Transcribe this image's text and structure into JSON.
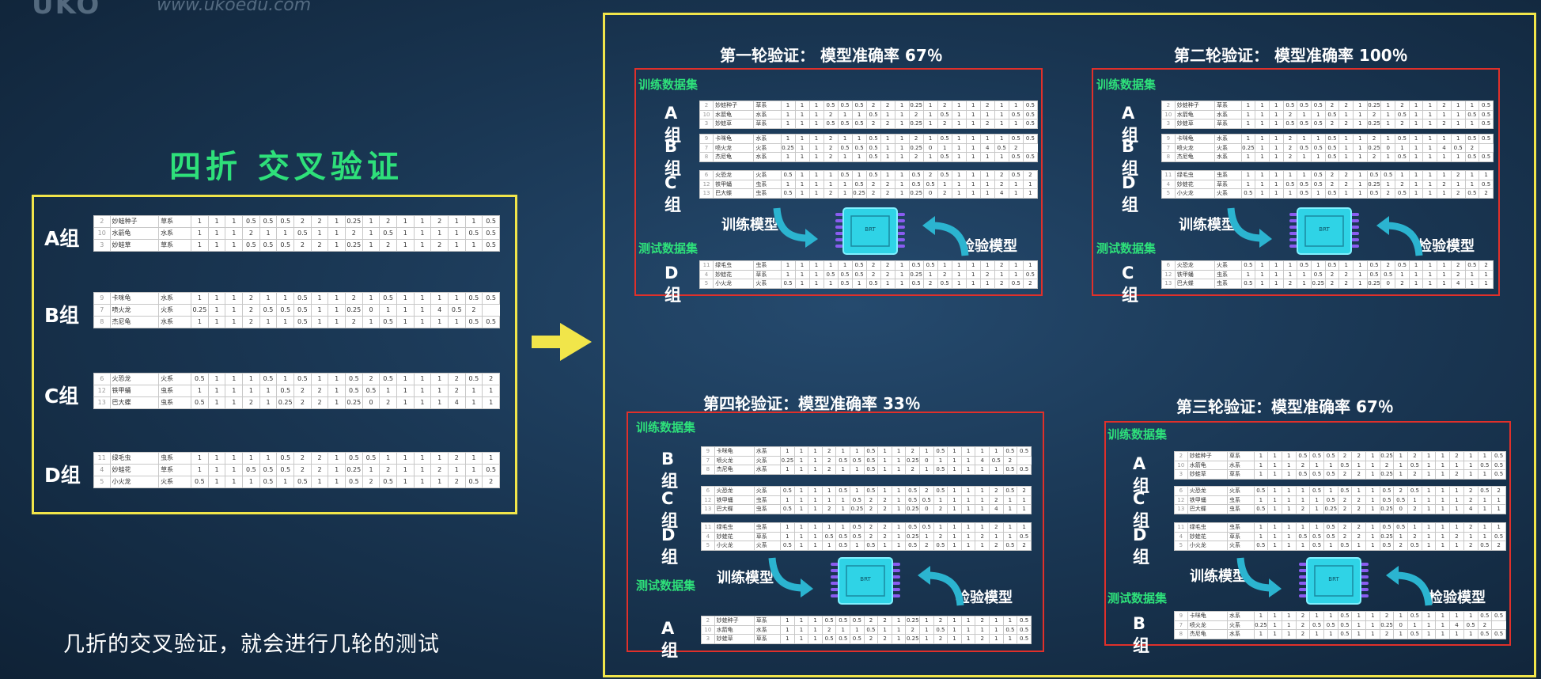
{
  "watermark": {
    "logo": "UKO",
    "url": "www.ukoedu.com"
  },
  "title": "四折 交叉验证",
  "caption": "几折的交叉验证，就会进行几轮的测试",
  "labels": {
    "train_set": "训练数据集",
    "test_set": "测试数据集",
    "train_model": "训练模型",
    "test_model": "检验模型",
    "chip": "BRT"
  },
  "groups": {
    "A": {
      "label": "A组",
      "rows": [
        [
          "2",
          "妙蛙种子",
          "草系",
          "1",
          "1",
          "1",
          "0.5",
          "0.5",
          "0.5",
          "2",
          "2",
          "1",
          "0.25",
          "1",
          "2",
          "1",
          "1",
          "2",
          "1",
          "1",
          "0.5"
        ],
        [
          "10",
          "水箭龟",
          "水系",
          "1",
          "1",
          "1",
          "2",
          "1",
          "1",
          "0.5",
          "1",
          "1",
          "2",
          "1",
          "0.5",
          "1",
          "1",
          "1",
          "1",
          "0.5",
          "0.5"
        ],
        [
          "3",
          "妙蛙草",
          "草系",
          "1",
          "1",
          "1",
          "0.5",
          "0.5",
          "0.5",
          "2",
          "2",
          "1",
          "0.25",
          "1",
          "2",
          "1",
          "1",
          "2",
          "1",
          "1",
          "0.5"
        ]
      ]
    },
    "B": {
      "label": "B组",
      "rows": [
        [
          "9",
          "卡咪龟",
          "水系",
          "1",
          "1",
          "1",
          "2",
          "1",
          "1",
          "0.5",
          "1",
          "1",
          "2",
          "1",
          "0.5",
          "1",
          "1",
          "1",
          "1",
          "0.5",
          "0.5"
        ],
        [
          "7",
          "喷火龙",
          "火系",
          "0.25",
          "1",
          "1",
          "2",
          "0.5",
          "0.5",
          "0.5",
          "1",
          "1",
          "0.25",
          "0",
          "1",
          "1",
          "1",
          "4",
          "0.5",
          "2"
        ],
        [
          "8",
          "杰尼龟",
          "水系",
          "1",
          "1",
          "1",
          "2",
          "1",
          "1",
          "0.5",
          "1",
          "1",
          "2",
          "1",
          "0.5",
          "1",
          "1",
          "1",
          "1",
          "0.5",
          "0.5"
        ]
      ]
    },
    "C": {
      "label": "C组",
      "rows": [
        [
          "6",
          "火恐龙",
          "火系",
          "0.5",
          "1",
          "1",
          "1",
          "0.5",
          "1",
          "0.5",
          "1",
          "1",
          "0.5",
          "2",
          "0.5",
          "1",
          "1",
          "1",
          "2",
          "0.5",
          "2"
        ],
        [
          "12",
          "铁甲蛹",
          "虫系",
          "1",
          "1",
          "1",
          "1",
          "1",
          "0.5",
          "2",
          "2",
          "1",
          "0.5",
          "0.5",
          "1",
          "1",
          "1",
          "1",
          "2",
          "1",
          "1"
        ],
        [
          "13",
          "巴大蝶",
          "虫系",
          "0.5",
          "1",
          "1",
          "2",
          "1",
          "0.25",
          "2",
          "2",
          "1",
          "0.25",
          "0",
          "2",
          "1",
          "1",
          "1",
          "4",
          "1",
          "1"
        ]
      ]
    },
    "D": {
      "label": "D组",
      "rows": [
        [
          "11",
          "绿毛虫",
          "虫系",
          "1",
          "1",
          "1",
          "1",
          "1",
          "0.5",
          "2",
          "2",
          "1",
          "0.5",
          "0.5",
          "1",
          "1",
          "1",
          "1",
          "2",
          "1",
          "1"
        ],
        [
          "4",
          "妙蛙花",
          "草系",
          "1",
          "1",
          "1",
          "0.5",
          "0.5",
          "0.5",
          "2",
          "2",
          "1",
          "0.25",
          "1",
          "2",
          "1",
          "1",
          "2",
          "1",
          "1",
          "0.5"
        ],
        [
          "5",
          "小火龙",
          "火系",
          "0.5",
          "1",
          "1",
          "1",
          "0.5",
          "1",
          "0.5",
          "1",
          "1",
          "0.5",
          "2",
          "0.5",
          "1",
          "1",
          "1",
          "2",
          "0.5",
          "2"
        ]
      ]
    }
  },
  "rounds": [
    {
      "title": "第一轮验证：  模型准确率 67％",
      "train": [
        "A",
        "B",
        "C"
      ],
      "test": "D"
    },
    {
      "title": "第二轮验证：  模型准确率 100％",
      "train": [
        "A",
        "B",
        "D"
      ],
      "test": "C"
    },
    {
      "title": "第四轮验证：模型准确率 33％",
      "train": [
        "B",
        "C",
        "D"
      ],
      "test": "A"
    },
    {
      "title": "第三轮验证：模型准确率 67％",
      "train": [
        "A",
        "C",
        "D"
      ],
      "test": "B"
    }
  ],
  "colors": {
    "frame": "#f1e54a",
    "round_box": "#e0302a",
    "green": "#2ee07a",
    "arrow_fill": "#2bb4d0",
    "chip_fill": "#2fd3e6"
  }
}
